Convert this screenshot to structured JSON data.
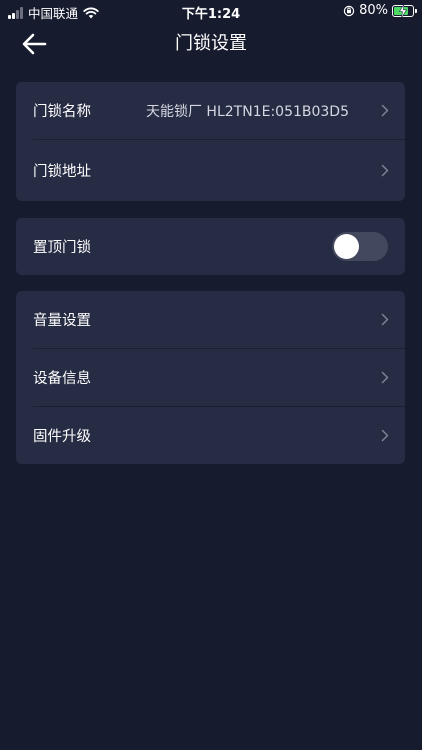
{
  "status_bar": {
    "carrier": "中国联通",
    "time": "下午1:24",
    "battery": "80%"
  },
  "nav": {
    "title": "门锁设置"
  },
  "lock_info": {
    "name_label": "门锁名称",
    "name_value": "天能锁厂 HL2TN1E:051B03D5",
    "address_label": "门锁地址"
  },
  "pin": {
    "label": "置顶门锁",
    "enabled": false
  },
  "settings": {
    "volume_label": "音量设置",
    "device_info_label": "设备信息",
    "firmware_label": "固件升级"
  },
  "icons": [
    "back-arrow-icon",
    "chevron-right-icon",
    "wifi-icon",
    "battery-icon",
    "rotation-lock-icon",
    "signal-icon"
  ],
  "colors": {
    "background": "#171b2e",
    "card": "#272c45",
    "toggle_off": "#43485f",
    "battery_fill": "#4cd964"
  }
}
